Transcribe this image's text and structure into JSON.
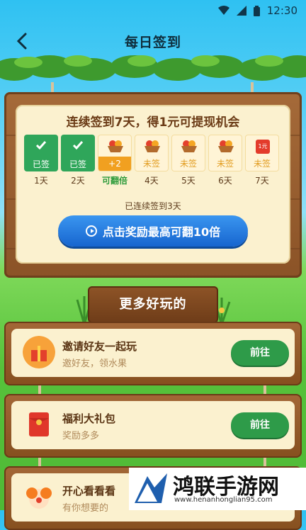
{
  "status_bar": {
    "time": "12:30"
  },
  "header": {
    "title": "每日签到"
  },
  "checkin": {
    "title": "连续签到7天，得1元可提现机会",
    "days": [
      {
        "status": "已签",
        "day": "1天",
        "icon": "check-icon"
      },
      {
        "status": "已签",
        "day": "2天",
        "icon": "check-icon"
      },
      {
        "status": "+2",
        "day": "可翻倍",
        "icon": "fruit-basket-icon"
      },
      {
        "status": "未签",
        "day": "4天",
        "icon": "fruit-basket-icon"
      },
      {
        "status": "未签",
        "day": "5天",
        "icon": "fruit-basket-icon"
      },
      {
        "status": "未签",
        "day": "6天",
        "icon": "fruit-basket-icon"
      },
      {
        "status": "未签",
        "day": "7天",
        "icon": "red-packet-icon",
        "badge": "1元"
      }
    ],
    "streak_text": "已连续签到3天",
    "double_button": "点击奖励最高可翻10倍"
  },
  "more": {
    "heading": "更多好玩的",
    "items": [
      {
        "title": "邀请好友一起玩",
        "subtitle": "邀好友，领水果",
        "button": "前往",
        "icon": "invite-gift-icon"
      },
      {
        "title": "福利大礼包",
        "subtitle": "奖励多多",
        "button": "前往",
        "icon": "red-envelope-icon"
      },
      {
        "title": "开心看看看",
        "subtitle": "有你想要的",
        "icon": "clown-icon"
      }
    ]
  },
  "watermark": {
    "title": "鸿联手游网",
    "url": "www.henanhonglian95.com"
  },
  "colors": {
    "green_button": "#2e9b49",
    "blue_button": "#1f73dc",
    "wood": "#8b5327",
    "paper": "#fbf1cf"
  }
}
